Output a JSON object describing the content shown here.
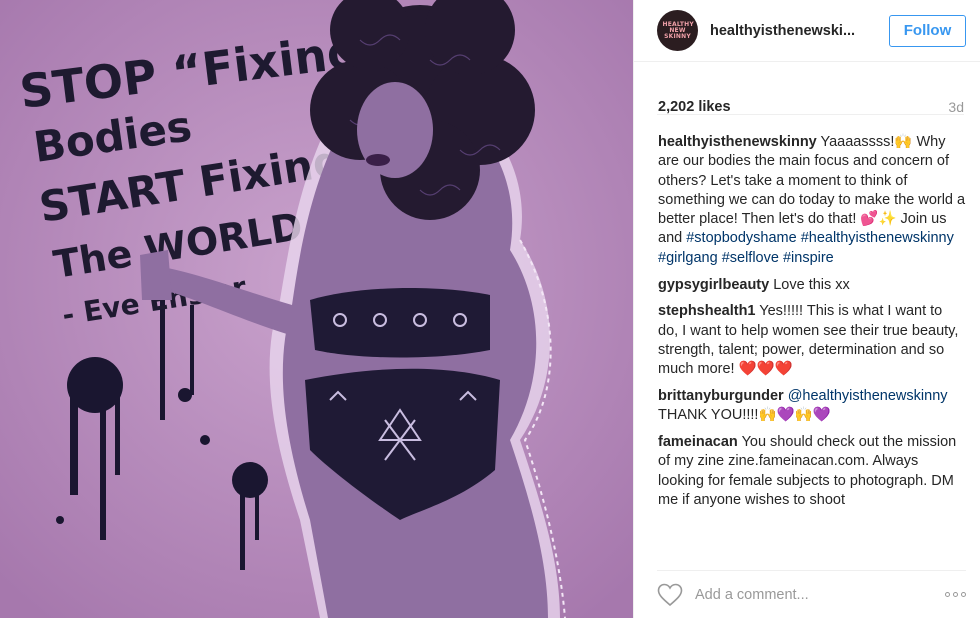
{
  "post": {
    "image": {
      "alt_lines": [
        "STOP “Fixing”",
        "Bodies",
        "START Fixing",
        "The WORLD",
        "- Eve Ensler"
      ]
    },
    "author": {
      "username": "healthyisthenewskinny",
      "username_display": "healthyisthenewski...",
      "avatar_text": "HEALTHY NEW SKINNY"
    },
    "follow_label": "Follow",
    "likes": "2,202 likes",
    "time_ago": "3d",
    "comments": [
      {
        "user": "healthyisthenewskinny",
        "text_parts": [
          {
            "t": " Yaaaassss!🙌 Why are our bodies the main focus and concern of others? Let's take a moment to think of something we can do today to make the world a better place! Then let's do that! 💕✨ Join us and ",
            "k": "text"
          },
          {
            "t": "#stopbodyshame",
            "k": "tag"
          },
          {
            "t": " ",
            "k": "text"
          },
          {
            "t": "#healthyisthenewskinny",
            "k": "tag"
          },
          {
            "t": " ",
            "k": "text"
          },
          {
            "t": "#girlgang",
            "k": "tag"
          },
          {
            "t": " ",
            "k": "text"
          },
          {
            "t": "#selflove",
            "k": "tag"
          },
          {
            "t": " ",
            "k": "text"
          },
          {
            "t": "#inspire",
            "k": "tag"
          }
        ]
      },
      {
        "user": "gypsygirlbeauty",
        "text_parts": [
          {
            "t": " Love this xx",
            "k": "text"
          }
        ]
      },
      {
        "user": "stephshealth1",
        "text_parts": [
          {
            "t": " Yes!!!!! This is what I want to do, I want to help women see their true beauty, strength, talent; power, determination and so much more! ❤️❤️❤️",
            "k": "text"
          }
        ]
      },
      {
        "user": "brittanyburgunder",
        "text_parts": [
          {
            "t": " ",
            "k": "text"
          },
          {
            "t": "@healthyisthenewskinny",
            "k": "tag"
          },
          {
            "t": " THANK YOU!!!!🙌💜🙌💜",
            "k": "text"
          }
        ]
      },
      {
        "user": "fameinacan",
        "text_parts": [
          {
            "t": " You should check out the mission of my zine zine.fameinacan.com. Always looking for female subjects to photograph. DM me if anyone wishes to shoot",
            "k": "text"
          }
        ]
      }
    ],
    "add_comment_placeholder": "Add a comment...",
    "icons": {
      "like": "heart-outline-icon",
      "more": "more-options-icon"
    },
    "colors": {
      "follow_blue": "#3897f0",
      "hashtag": "#003569",
      "muted": "#999999",
      "image_bg": "#b386b8"
    }
  }
}
